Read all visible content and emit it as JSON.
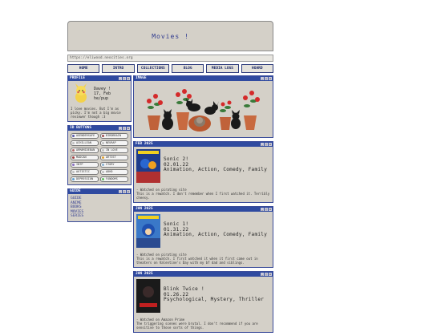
{
  "header": {
    "title": "Movies !"
  },
  "url": "https://eliwood.neocities.org",
  "nav": [
    "HOME",
    "INTRO",
    "COLLECTIONS",
    "BLOG",
    "MEDIA LOGS",
    "HOARD"
  ],
  "profile": {
    "title": "PROFILE",
    "name": "Davey !",
    "birthday": "17, Feb",
    "pronouns": "he/pup",
    "bio": "I love movies. But I'm as picky. I'm not a big movie reviewer though :3"
  },
  "id_buttons": {
    "title": "ID BUTTONS",
    "buttons": [
      {
        "label": "AGENDERSAFE",
        "color": "#5a5aa8"
      },
      {
        "label": "BIRDBRAIN",
        "color": "#a05050"
      },
      {
        "label": "ACHILLEAN",
        "color": "#c0c0c0"
      },
      {
        "label": "NEURAP",
        "color": "#c0c0c0"
      },
      {
        "label": "ARMAMIDEBAN",
        "color": "#b06a6a"
      },
      {
        "label": "IN LOVE",
        "color": "#c0c0c0"
      },
      {
        "label": "MADCAN",
        "color": "#a04040"
      },
      {
        "label": "ARTIST",
        "color": "#e0a030"
      },
      {
        "label": "INTP",
        "color": "#8a70c0"
      },
      {
        "label": "STORY",
        "color": "#8ab0d0"
      },
      {
        "label": "AUTISTIC",
        "color": "#c0c0c0"
      },
      {
        "label": "ADHD",
        "color": "#c0c0c0"
      },
      {
        "label": "DEPRESSION",
        "color": "#60a0d0"
      },
      {
        "label": "FANDOMS",
        "color": "#60c060"
      }
    ]
  },
  "guide": {
    "title": "GUIDE",
    "items": [
      "guide",
      "anime",
      "books",
      "movies",
      "series"
    ]
  },
  "image_panel": {
    "title": "IMAGE"
  },
  "entries": [
    {
      "date": "FEB 2025",
      "title": "Sonic 2!",
      "watched": "02.01.22",
      "genres": "Animation, Action, Comedy, Family",
      "source": "- Watched on pirating site",
      "note": "This is a rewatch. I don't remember when I first watched it. Terribly cheesy.",
      "poster_color": "#b03030"
    },
    {
      "date": "JAN 2025",
      "title": "Sonic 1!",
      "watched": "01.31.22",
      "genres": "Animation, Action, Comedy, Family",
      "source": "- Watched on pirating site",
      "note": "This is a rewatch. I first watched it when it first came out in theaters on Valentine's Day with my bf dad and siblings.",
      "poster_color": "#2a5aa8"
    },
    {
      "date": "JAN 2025",
      "title": "Blink Twice !",
      "watched": "01.26.22",
      "genres": "Psychological, Mystery, Thriller",
      "source": "- Watched on Amazon Prime",
      "note": "The triggering scenes were brutal. I don't recommend if you are sensitive to those sorts of things.",
      "poster_color": "#222222"
    }
  ]
}
